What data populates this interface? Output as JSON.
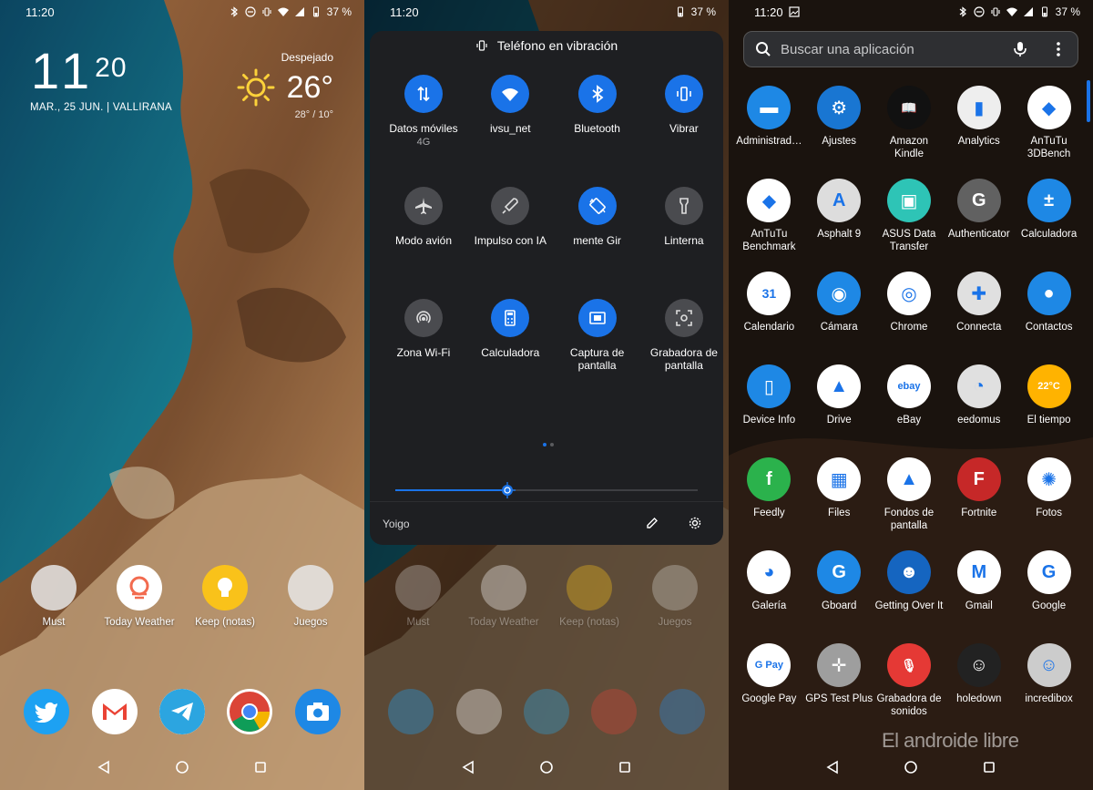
{
  "colors": {
    "accent": "#1a73e8",
    "panel_bg": "#1e1f22",
    "tile_off": "#4a4b4f"
  },
  "home": {
    "status_time": "11:20",
    "battery": "37 %",
    "clock_hour": "11",
    "clock_min": "20",
    "date_location": "MAR., 25 JUN. | VALLIRANA",
    "weather": {
      "condition": "Despejado",
      "temp": "26°",
      "range": "28° / 10°",
      "icon": "sun-icon"
    },
    "apps": [
      {
        "label": "Must",
        "type": "folder"
      },
      {
        "label": "Today Weather",
        "icon": "today-weather-icon"
      },
      {
        "label": "Keep (notas)",
        "icon": "keep-icon"
      },
      {
        "label": "Juegos",
        "type": "folder"
      }
    ],
    "dock": [
      {
        "name": "Twitter",
        "icon": "twitter-icon"
      },
      {
        "name": "Gmail",
        "icon": "gmail-icon"
      },
      {
        "name": "Telegram",
        "icon": "telegram-icon"
      },
      {
        "name": "Chrome",
        "icon": "chrome-icon"
      },
      {
        "name": "Cámara",
        "icon": "camera-icon"
      }
    ]
  },
  "quick_settings": {
    "status_time": "11:20",
    "battery": "37 %",
    "header": "Teléfono en vibración",
    "tiles": [
      {
        "label": "Datos móviles",
        "sub": "4G",
        "on": true,
        "icon": "mobile-data-icon"
      },
      {
        "label": "ivsu_net",
        "sub": "",
        "on": true,
        "icon": "wifi-icon"
      },
      {
        "label": "Bluetooth",
        "sub": "",
        "on": true,
        "icon": "bluetooth-icon"
      },
      {
        "label": "Vibrar",
        "sub": "",
        "on": true,
        "icon": "vibrate-icon"
      },
      {
        "label": "Modo avión",
        "sub": "",
        "on": false,
        "icon": "airplane-icon"
      },
      {
        "label": "Impulso con IA",
        "sub": "",
        "on": false,
        "icon": "rocket-icon"
      },
      {
        "label": "mente     Gir",
        "sub": "",
        "on": true,
        "icon": "rotate-icon"
      },
      {
        "label": "Linterna",
        "sub": "",
        "on": false,
        "icon": "flashlight-icon"
      },
      {
        "label": "Zona Wi-Fi",
        "sub": "",
        "on": false,
        "icon": "hotspot-icon"
      },
      {
        "label": "Calculadora",
        "sub": "",
        "on": true,
        "icon": "calculator-icon"
      },
      {
        "label": "Captura de pantalla",
        "sub": "",
        "on": true,
        "icon": "screenshot-icon"
      },
      {
        "label": "Grabadora de pantalla",
        "sub": "",
        "on": false,
        "icon": "screen-record-icon"
      }
    ],
    "brightness": 0.37,
    "carrier": "Yoigo"
  },
  "drawer": {
    "status_time": "11:20",
    "battery": "37 %",
    "search_placeholder": "Buscar una aplicación",
    "apps": [
      {
        "label": "Administrad…",
        "bg": "#1e88e5",
        "glyph": "▬"
      },
      {
        "label": "Ajustes",
        "bg": "#1976d2",
        "glyph": "⚙"
      },
      {
        "label": "Amazon Kindle",
        "bg": "#111111",
        "glyph": "📖"
      },
      {
        "label": "Analytics",
        "bg": "#eeeeee",
        "glyph": "▮"
      },
      {
        "label": "AnTuTu 3DBench",
        "bg": "#ffffff",
        "glyph": "◆"
      },
      {
        "label": "AnTuTu Benchmark",
        "bg": "#ffffff",
        "glyph": "◆"
      },
      {
        "label": "Asphalt 9",
        "bg": "#dddddd",
        "glyph": "A"
      },
      {
        "label": "ASUS Data Transfer",
        "bg": "#2ec4b6",
        "glyph": "▣"
      },
      {
        "label": "Authenticator",
        "bg": "#616161",
        "glyph": "G"
      },
      {
        "label": "Calculadora",
        "bg": "#1e88e5",
        "glyph": "±"
      },
      {
        "label": "Calendario",
        "bg": "#ffffff",
        "glyph": "31"
      },
      {
        "label": "Cámara",
        "bg": "#1e88e5",
        "glyph": "◉"
      },
      {
        "label": "Chrome",
        "bg": "#ffffff",
        "glyph": "◎"
      },
      {
        "label": "Connecta",
        "bg": "#e0e0e0",
        "glyph": "✚"
      },
      {
        "label": "Contactos",
        "bg": "#1e88e5",
        "glyph": "●"
      },
      {
        "label": "Device Info",
        "bg": "#1e88e5",
        "glyph": "▯"
      },
      {
        "label": "Drive",
        "bg": "#ffffff",
        "glyph": "▲"
      },
      {
        "label": "eBay",
        "bg": "#ffffff",
        "glyph": "ebay"
      },
      {
        "label": "eedomus",
        "bg": "#e0e0e0",
        "glyph": "◔"
      },
      {
        "label": "El tiempo",
        "bg": "#ffb300",
        "glyph": "22°C"
      },
      {
        "label": "Feedly",
        "bg": "#2bb24c",
        "glyph": "f"
      },
      {
        "label": "Files",
        "bg": "#ffffff",
        "glyph": "▦"
      },
      {
        "label": "Fondos de pantalla",
        "bg": "#ffffff",
        "glyph": "▲"
      },
      {
        "label": "Fortnite",
        "bg": "#c62828",
        "glyph": "F"
      },
      {
        "label": "Fotos",
        "bg": "#ffffff",
        "glyph": "✺"
      },
      {
        "label": "Galería",
        "bg": "#ffffff",
        "glyph": "◕"
      },
      {
        "label": "Gboard",
        "bg": "#1e88e5",
        "glyph": "G"
      },
      {
        "label": "Getting Over It",
        "bg": "#1565c0",
        "glyph": "☻"
      },
      {
        "label": "Gmail",
        "bg": "#ffffff",
        "glyph": "M"
      },
      {
        "label": "Google",
        "bg": "#ffffff",
        "glyph": "G"
      },
      {
        "label": "Google Pay",
        "bg": "#ffffff",
        "glyph": "G Pay"
      },
      {
        "label": "GPS Test Plus",
        "bg": "#9e9e9e",
        "glyph": "✛"
      },
      {
        "label": "Grabadora de sonidos",
        "bg": "#e53935",
        "glyph": "🎙"
      },
      {
        "label": "holedown",
        "bg": "#222222",
        "glyph": "☺"
      },
      {
        "label": "incredibox",
        "bg": "#cccccc",
        "glyph": "☺"
      }
    ],
    "watermark": "El androide libre"
  }
}
